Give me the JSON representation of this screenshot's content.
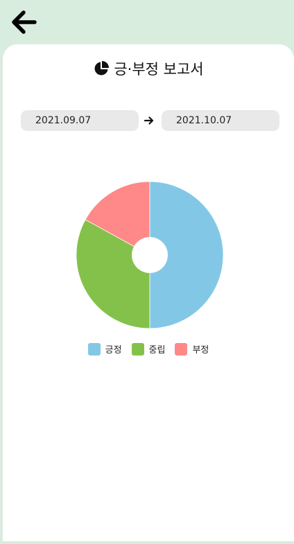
{
  "header": {
    "back_icon": "arrow-left-icon"
  },
  "report": {
    "title_icon": "pie-chart-icon",
    "title": "긍·부정 보고서"
  },
  "date_range": {
    "start": "2021.09.07",
    "end": "2021.10.07",
    "separator_icon": "arrow-right-icon"
  },
  "colors": {
    "background": "#d9eddf",
    "positive": "#82c8e6",
    "neutral": "#84c14a",
    "negative": "#ff8888"
  },
  "chart_data": {
    "type": "pie",
    "donut": true,
    "categories": [
      "긍정",
      "중립",
      "부정"
    ],
    "values": [
      50,
      33,
      17
    ],
    "colors": [
      "#82c8e6",
      "#84c14a",
      "#ff8888"
    ],
    "title": "",
    "legend_position": "bottom"
  }
}
